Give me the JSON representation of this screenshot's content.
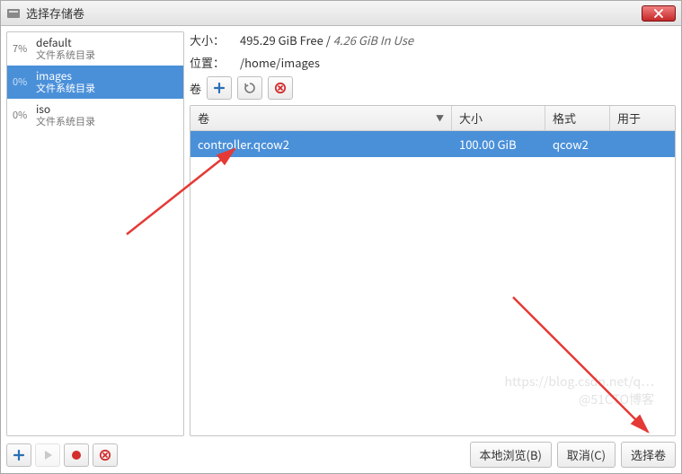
{
  "window": {
    "title": "选择存储卷",
    "close_label": "close"
  },
  "pools": [
    {
      "pct": "7%",
      "name": "default",
      "sub": "文件系统目录",
      "selected": false
    },
    {
      "pct": "0%",
      "name": "images",
      "sub": "文件系统目录",
      "selected": true
    },
    {
      "pct": "0%",
      "name": "iso",
      "sub": "文件系统目录",
      "selected": false
    }
  ],
  "detail": {
    "size_label": "大小：",
    "size_free": "495.29 GiB Free",
    "size_sep": " / ",
    "size_inuse": "4.26 GiB In Use",
    "loc_label": "位置：",
    "loc_value": "/home/images",
    "vol_label": "卷"
  },
  "vol_toolbar": {
    "add": "add-volume",
    "refresh": "refresh-volumes",
    "delete": "delete-volume"
  },
  "columns": {
    "name": "卷",
    "size": "大小",
    "fmt": "格式",
    "used": "用于"
  },
  "volumes": [
    {
      "name": "controller.qcow2",
      "size": "100.00 GiB",
      "fmt": "qcow2",
      "used": "",
      "selected": true
    }
  ],
  "footer": {
    "browse": "本地浏览(B)",
    "cancel": "取消(C)",
    "choose": "选择卷"
  },
  "watermark": {
    "line1": "https://blog.csdn.net/q…",
    "line2": "@51CTO博客"
  }
}
